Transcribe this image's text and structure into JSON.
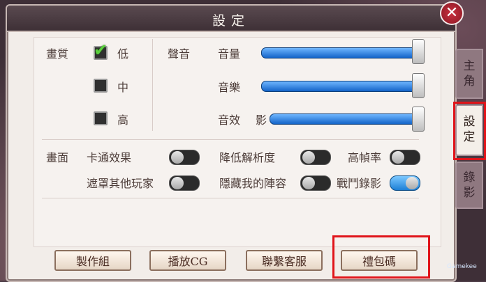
{
  "title": "設定",
  "quality": {
    "label": "畫質",
    "options": [
      "低",
      "中",
      "高"
    ],
    "selected": "低"
  },
  "sound": {
    "label": "聲音",
    "sliders": [
      {
        "label": "音量",
        "value": 100
      },
      {
        "label": "音樂",
        "value": 100
      },
      {
        "label": "音效",
        "value": 100
      }
    ]
  },
  "screen": {
    "label": "畫面",
    "toggles": [
      {
        "label": "卡通效果",
        "on": false
      },
      {
        "label": "降低解析度",
        "on": false
      },
      {
        "label": "高幀率",
        "on": false
      },
      {
        "label": "遮罩其他玩家",
        "on": false
      },
      {
        "label": "隱藏我的陣容",
        "on": false
      },
      {
        "label": "戰鬥錄影",
        "on": true
      }
    ]
  },
  "buttons": [
    "製作組",
    "播放CG",
    "聯繫客服",
    "禮包碼"
  ],
  "side_tabs": [
    "主角",
    "設定",
    "錄影"
  ],
  "close_glyph": "✕",
  "check_glyph": "✔",
  "overlay_text": "影",
  "watermark": "Gamekee"
}
